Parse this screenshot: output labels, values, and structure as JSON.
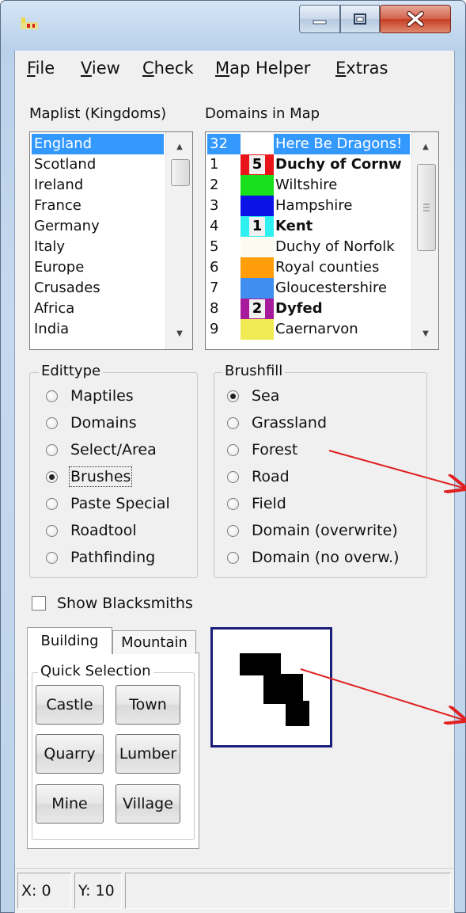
{
  "menu": {
    "items": [
      {
        "accel": "F",
        "rest": "ile"
      },
      {
        "accel": "V",
        "rest": "iew"
      },
      {
        "accel": "C",
        "rest": "heck"
      },
      {
        "accel": "M",
        "rest": "ap Helper"
      },
      {
        "accel": "E",
        "rest": "xtras"
      }
    ]
  },
  "maplist": {
    "label": "Maplist (Kingdoms)",
    "items": [
      "England",
      "Scotland",
      "Ireland",
      "France",
      "Germany",
      "Italy",
      "Europe",
      "Crusades",
      "Africa",
      "India"
    ],
    "selected_index": 0
  },
  "domains": {
    "label": "Domains in Map",
    "rows": [
      {
        "num": "32",
        "name": "Here Be Dragons!",
        "color": "#ffffff",
        "badge": "",
        "bold": false,
        "selected": true
      },
      {
        "num": "1",
        "name": "Duchy of Cornw",
        "color": "#e8141a",
        "badge": "5",
        "bold": true,
        "selected": false
      },
      {
        "num": "2",
        "name": "Wiltshire",
        "color": "#18e01c",
        "badge": "",
        "bold": false,
        "selected": false
      },
      {
        "num": "3",
        "name": "Hampshire",
        "color": "#0a12e6",
        "badge": "",
        "bold": false,
        "selected": false
      },
      {
        "num": "4",
        "name": "Kent",
        "color": "#2ff0f0",
        "badge": "1",
        "bold": true,
        "selected": false
      },
      {
        "num": "5",
        "name": "Duchy of Norfolk",
        "color": "#fbfbf2",
        "badge": "",
        "bold": false,
        "selected": false
      },
      {
        "num": "6",
        "name": "Royal counties",
        "color": "#ff9d0a",
        "badge": "",
        "bold": false,
        "selected": false
      },
      {
        "num": "7",
        "name": "Gloucestershire",
        "color": "#3f8ef0",
        "badge": "",
        "bold": false,
        "selected": false
      },
      {
        "num": "8",
        "name": "Dyfed",
        "color": "#a81a9c",
        "badge": "2",
        "bold": true,
        "selected": false
      },
      {
        "num": "9",
        "name": "Caernarvon",
        "color": "#f0eb52",
        "badge": "",
        "bold": false,
        "selected": false
      }
    ]
  },
  "edittype": {
    "legend": "Edittype",
    "options": [
      "Maptiles",
      "Domains",
      "Select/Area",
      "Brushes",
      "Paste Special",
      "Roadtool",
      "Pathfinding"
    ],
    "selected_index": 3
  },
  "brushfill": {
    "legend": "Brushfill",
    "options": [
      "Sea",
      "Grassland",
      "Forest",
      "Road",
      "Field",
      "Domain (overwrite)",
      "Domain (no overw.)"
    ],
    "selected_index": 0
  },
  "show_blacksmiths": {
    "label": "Show Blacksmiths",
    "checked": false
  },
  "tabs": {
    "items": [
      "Building",
      "Mountain"
    ],
    "active_index": 0
  },
  "quick_selection": {
    "legend": "Quick Selection",
    "buttons": [
      "Castle",
      "Town",
      "Quarry",
      "Lumber",
      "Mine",
      "Village"
    ]
  },
  "status": {
    "x": "X: 0",
    "y": "Y: 10",
    "extra": ""
  },
  "colors": {
    "selection": "#3399ff",
    "annotation_arrow": "#e02020",
    "preview_border": "#1b1f7a"
  }
}
